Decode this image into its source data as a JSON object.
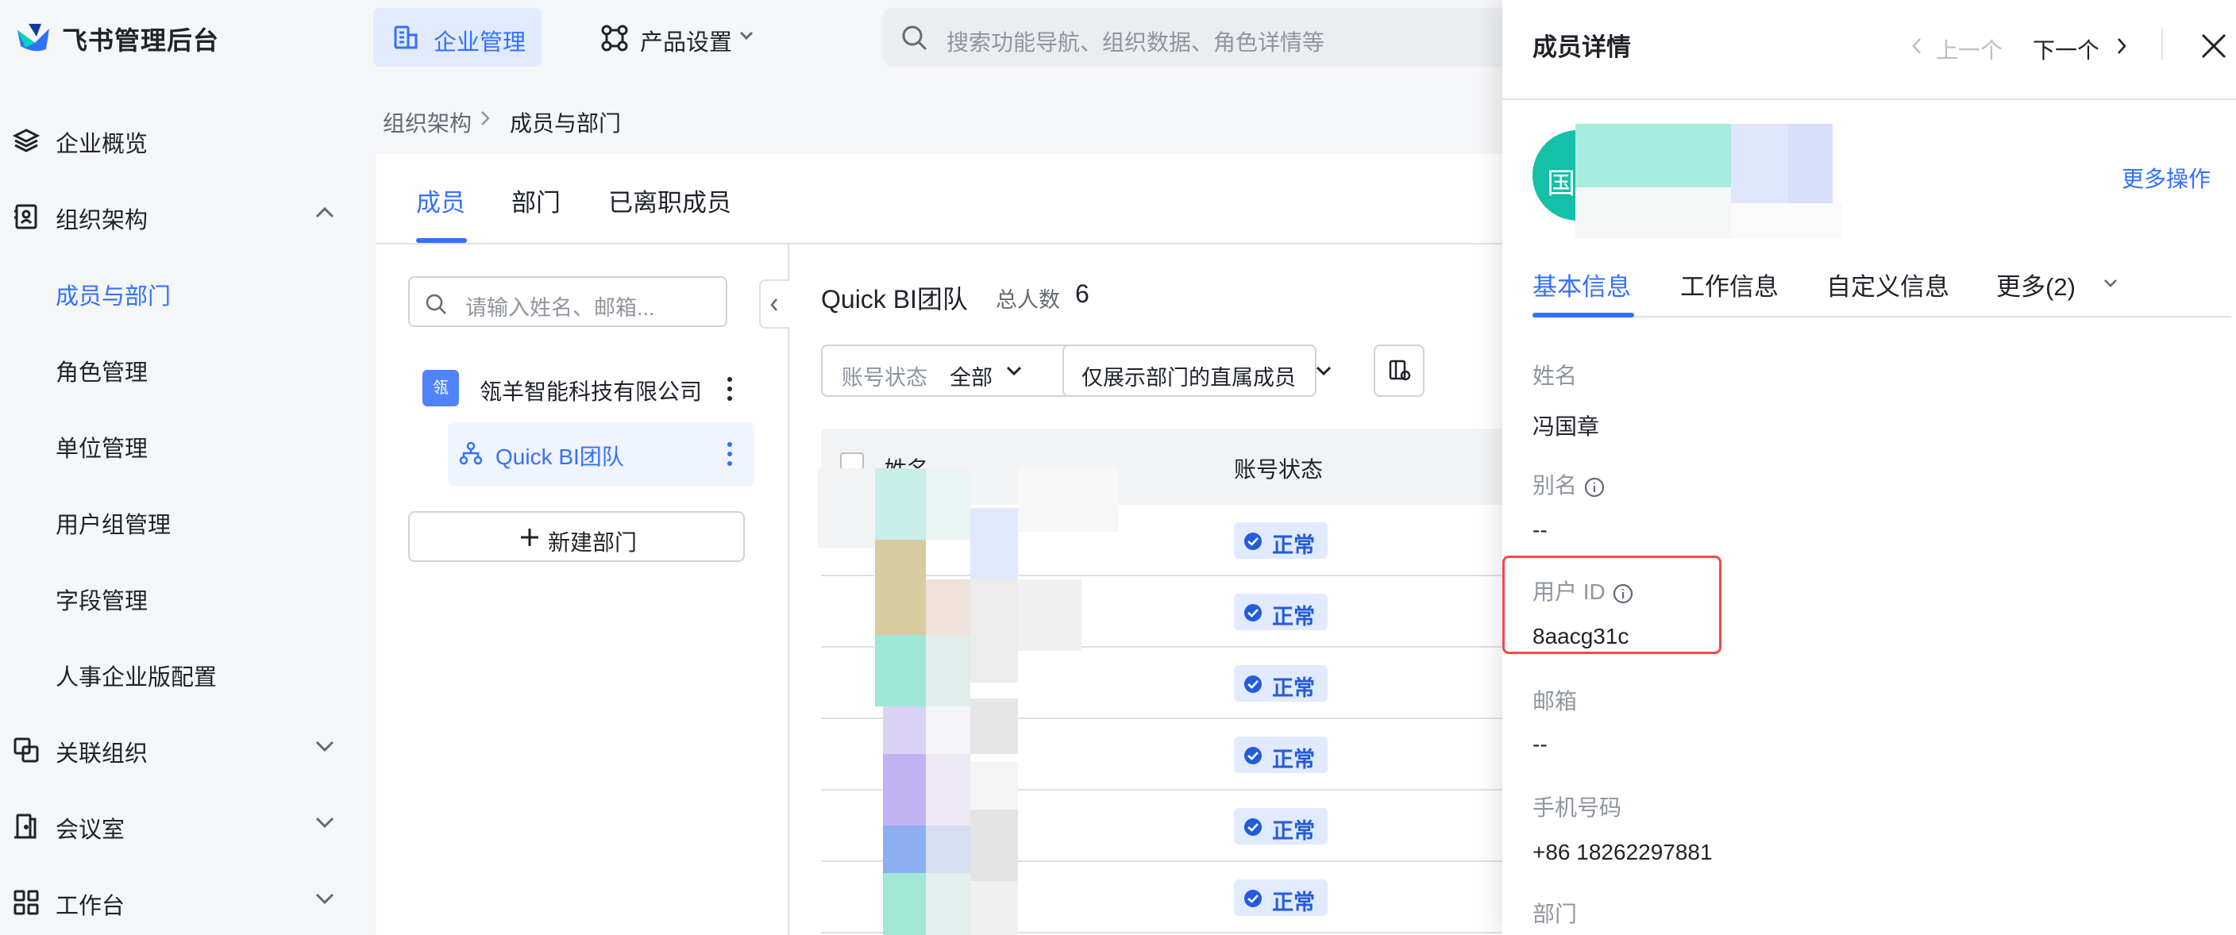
{
  "app": {
    "title": "飞书管理后台"
  },
  "top_nav": {
    "enterprise": "企业管理",
    "product": "产品设置",
    "search_placeholder": "搜索功能导航、组织数据、角色详情等"
  },
  "sidebar": {
    "items": [
      {
        "label": "企业概览"
      },
      {
        "label": "组织架构"
      },
      {
        "label": "成员与部门"
      },
      {
        "label": "角色管理"
      },
      {
        "label": "单位管理"
      },
      {
        "label": "用户组管理"
      },
      {
        "label": "字段管理"
      },
      {
        "label": "人事企业版配置"
      },
      {
        "label": "关联组织"
      },
      {
        "label": "会议室"
      },
      {
        "label": "工作台"
      }
    ]
  },
  "breadcrumb": {
    "parent": "组织架构",
    "current": "成员与部门"
  },
  "tabs": [
    "成员",
    "部门",
    "已离职成员"
  ],
  "tree": {
    "search_placeholder": "请输入姓名、邮箱...",
    "company": "瓴羊智能科技有限公司",
    "company_logo_text": "瓴",
    "team": "Quick BI团队",
    "new_dept": "新建部门"
  },
  "member_list": {
    "title": "Quick BI团队",
    "total_label": "总人数",
    "total_count": "6",
    "filter_status_key": "账号状态",
    "filter_status_value": "全部",
    "filter_direct": "仅展示部门的直属成员",
    "columns": [
      "姓名",
      "账号状态"
    ],
    "rows": [
      {
        "status": "正常"
      },
      {
        "status": "正常"
      },
      {
        "status": "正常"
      },
      {
        "status": "正常"
      },
      {
        "status": "正常"
      },
      {
        "status": "正常"
      }
    ]
  },
  "drawer": {
    "title": "成员详情",
    "prev": "上一个",
    "next": "下一个",
    "avatar_text": "国",
    "more_actions": "更多操作",
    "tabs": [
      "基本信息",
      "工作信息",
      "自定义信息",
      "更多(2)"
    ],
    "fields": [
      {
        "label": "姓名",
        "value": "冯国章"
      },
      {
        "label": "别名",
        "value": "--"
      },
      {
        "label": "用户 ID",
        "value": "8aacg31c"
      },
      {
        "label": "邮箱",
        "value": "--"
      },
      {
        "label": "手机号码",
        "value": "+86 18262297881"
      },
      {
        "label": "部门",
        "value": ""
      }
    ]
  },
  "colors": {
    "accent": "#3370ff",
    "badge_bg": "#e1eaff",
    "highlight": "#f54a45",
    "avatar": "#14c0a8"
  }
}
